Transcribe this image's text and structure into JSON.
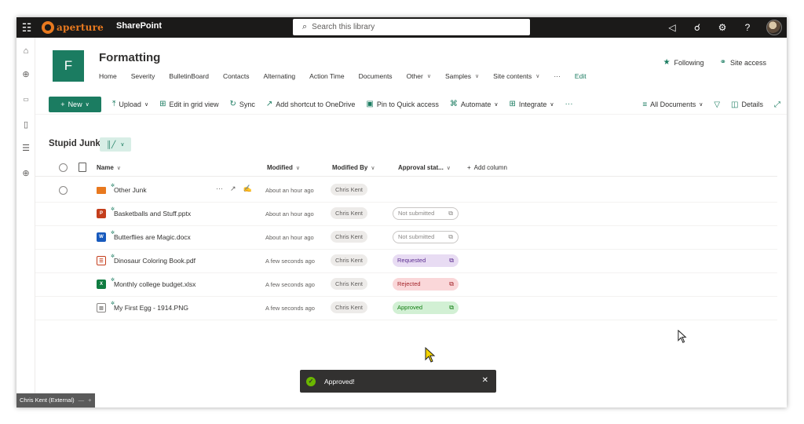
{
  "suite": {
    "brand": "aperture",
    "app_name": "SharePoint",
    "search_placeholder": "Search this library",
    "icons": [
      "waffle-icon",
      "megaphone-icon",
      "share-icon",
      "gear-icon",
      "help-icon"
    ],
    "help_label": "?"
  },
  "site": {
    "logo_letter": "F",
    "title": "Formatting",
    "nav": [
      {
        "label": "Home",
        "dropdown": false
      },
      {
        "label": "Severity",
        "dropdown": false
      },
      {
        "label": "BulletinBoard",
        "dropdown": false
      },
      {
        "label": "Contacts",
        "dropdown": false
      },
      {
        "label": "Alternating",
        "dropdown": false
      },
      {
        "label": "Action Time",
        "dropdown": false
      },
      {
        "label": "Documents",
        "dropdown": false
      },
      {
        "label": "Other",
        "dropdown": true
      },
      {
        "label": "Samples",
        "dropdown": true
      },
      {
        "label": "Site contents",
        "dropdown": true
      }
    ],
    "nav_more": "···",
    "nav_edit": "Edit",
    "following_label": "Following",
    "site_access_label": "Site access"
  },
  "cmdbar": {
    "new_label": "New",
    "upload_label": "Upload",
    "edit_grid_label": "Edit in grid view",
    "sync_label": "Sync",
    "add_shortcut_label": "Add shortcut to OneDrive",
    "pin_label": "Pin to Quick access",
    "automate_label": "Automate",
    "integrate_label": "Integrate",
    "more_label": "···",
    "view_label": "All Documents",
    "details_label": "Details"
  },
  "library": {
    "title": "Stupid Junk",
    "columns": {
      "name": "Name",
      "modified": "Modified",
      "modified_by": "Modified By",
      "approval": "Approval stat...",
      "add_column": "Add column"
    },
    "rows": [
      {
        "name": "Other Junk",
        "type": "folder",
        "modified": "About an hour ago",
        "modified_by": "Chris Kent",
        "approval": ""
      },
      {
        "name": "Basketballs and Stuff.pptx",
        "type": "pptx",
        "modified": "About an hour ago",
        "modified_by": "Chris Kent",
        "approval": "Not submitted"
      },
      {
        "name": "Butterflies are Magic.docx",
        "type": "docx",
        "modified": "About an hour ago",
        "modified_by": "Chris Kent",
        "approval": "Not submitted"
      },
      {
        "name": "Dinosaur Coloring Book.pdf",
        "type": "pdf",
        "modified": "A few seconds ago",
        "modified_by": "Chris Kent",
        "approval": "Requested"
      },
      {
        "name": "Monthly college budget.xlsx",
        "type": "xlsx",
        "modified": "A few seconds ago",
        "modified_by": "Chris Kent",
        "approval": "Rejected"
      },
      {
        "name": "My First Egg - 1914.PNG",
        "type": "png",
        "modified": "A few seconds ago",
        "modified_by": "Chris Kent",
        "approval": "Approved"
      }
    ]
  },
  "toast": {
    "message": "Approved!"
  },
  "user_tab": {
    "label": "Chris Kent (External)",
    "minimize": "—",
    "add": "+"
  },
  "colors": {
    "accent": "#1b7c61",
    "suite_bar": "#1b1a19",
    "brand": "#e8791f",
    "requested": "#e8dcf3",
    "rejected": "#fad7d9",
    "approved": "#d2f0d4"
  }
}
